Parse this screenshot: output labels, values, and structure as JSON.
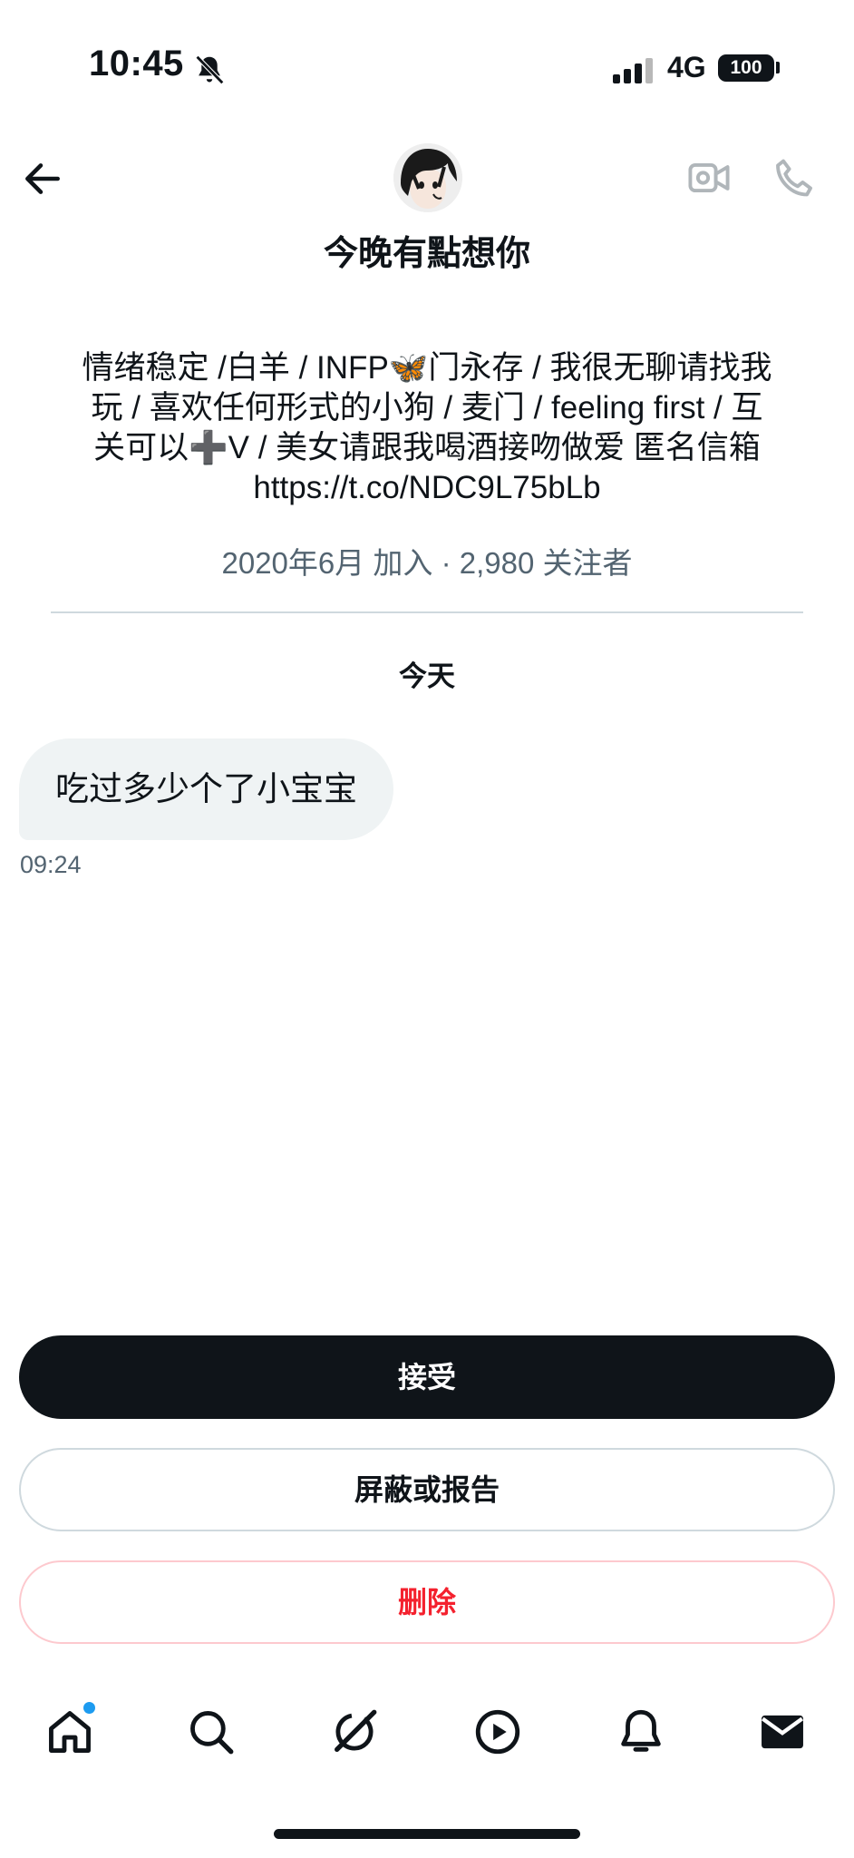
{
  "status_bar": {
    "time": "10:45",
    "network": "4G",
    "battery": "100"
  },
  "header": {
    "display_name": "今晚有點想你"
  },
  "profile": {
    "bio_lines": [
      "情绪稳定 /白羊 / INFP🦋门永存 / 我很无聊请找我",
      "玩 / 喜欢任何形式的小狗 / 麦门 / feeling first / 互",
      "关可以➕V / 美女请跟我喝酒接吻做爱 匿名信箱",
      "https://t.co/NDC9L75bLb"
    ],
    "joined": "2020年6月 加入",
    "followers": "2,980 关注者"
  },
  "chat": {
    "day_label": "今天",
    "messages": [
      {
        "text": "吃过多少个了小宝宝",
        "time": "09:24"
      }
    ]
  },
  "actions": {
    "accept_label": "接受",
    "block_report_label": "屏蔽或报告",
    "delete_label": "删除"
  },
  "tab_bar": {
    "icons": [
      "home-icon",
      "search-icon",
      "grok-icon",
      "video-icon",
      "notifications-icon",
      "messages-icon"
    ],
    "unread_dot_color": "#1d9bf0"
  },
  "colors": {
    "text": "#0f1419",
    "secondary": "#536471",
    "danger": "#f4212e",
    "bubble": "#eff3f4"
  }
}
